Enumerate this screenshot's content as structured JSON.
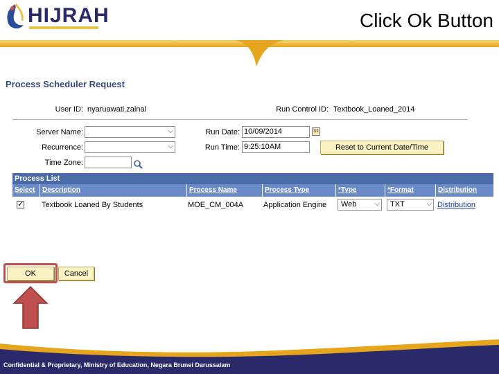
{
  "slide": {
    "logo_text": "HIJRAH",
    "title": "Click Ok Button",
    "footer": "Confidential & Proprietary, Ministry of Education, Negara Brunei Darussalam"
  },
  "page": {
    "title": "Process Scheduler Request",
    "user_id_label": "User ID:",
    "user_id_value": "nyaruawati.zainal",
    "run_control_label": "Run Control ID:",
    "run_control_value": "Textbook_Loaned_2014",
    "server_name_label": "Server Name:",
    "recurrence_label": "Recurrence:",
    "time_zone_label": "Time Zone:",
    "run_date_label": "Run Date:",
    "run_date_value": "10/09/2014",
    "run_time_label": "Run Time:",
    "run_time_value": "9:25:10AM",
    "reset_button": "Reset to Current Date/Time"
  },
  "process_list": {
    "title": "Process List",
    "columns": [
      "Select",
      "Description",
      "Process Name",
      "Process Type",
      "*Type",
      "*Format",
      "Distribution"
    ],
    "rows": [
      {
        "selected": true,
        "description": "Textbook Loaned By Students",
        "process_name": "MOE_CM_004A",
        "process_type": "Application Engine",
        "type": "Web",
        "format": "TXT",
        "distribution": "Distribution"
      }
    ]
  },
  "actions": {
    "ok": "OK",
    "cancel": "Cancel"
  },
  "colors": {
    "gold": "#e6a51c",
    "grid_header": "#4a6aa8",
    "highlight": "#c0504d"
  }
}
